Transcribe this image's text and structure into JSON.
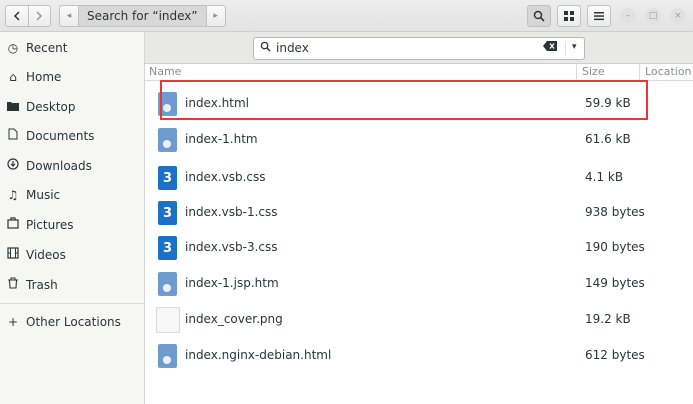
{
  "header": {
    "back_icon": "chevron-left-icon",
    "forward_icon": "chevron-right-icon",
    "path_left_arrow": "◂",
    "search_crumb": "Search for “index”",
    "path_right_arrow": "▸",
    "search_icon": "🔍",
    "view_icon": "grid-icon",
    "menu_icon": "hamburger-icon"
  },
  "window_controls": {
    "minimize": "–",
    "maximize": "□",
    "close": "×"
  },
  "sidebar": {
    "items": [
      {
        "icon": "clock-icon",
        "label": "Recent"
      },
      {
        "icon": "home-icon",
        "label": "Home"
      },
      {
        "icon": "folder-icon",
        "label": "Desktop"
      },
      {
        "icon": "document-icon",
        "label": "Documents"
      },
      {
        "icon": "download-icon",
        "label": "Downloads"
      },
      {
        "icon": "music-icon",
        "label": "Music"
      },
      {
        "icon": "pictures-icon",
        "label": "Pictures"
      },
      {
        "icon": "video-icon",
        "label": "Videos"
      },
      {
        "icon": "trash-icon",
        "label": "Trash"
      }
    ],
    "other_locations": {
      "icon": "plus-icon",
      "label": "Other Locations"
    }
  },
  "search": {
    "value": "index",
    "placeholder": ""
  },
  "columns": {
    "name": "Name",
    "size": "Size",
    "location": "Location"
  },
  "files": [
    {
      "name": "index.html",
      "size": "59.9 kB",
      "type": "html"
    },
    {
      "name": "index-1.htm",
      "size": "61.6 kB",
      "type": "html"
    },
    {
      "name": "index.vsb.css",
      "size": "4.1 kB",
      "type": "css"
    },
    {
      "name": "index.vsb-1.css",
      "size": "938 bytes",
      "type": "css"
    },
    {
      "name": "index.vsb-3.css",
      "size": "190 bytes",
      "type": "css"
    },
    {
      "name": "index-1.jsp.htm",
      "size": "149 bytes",
      "type": "html"
    },
    {
      "name": "index_cover.png",
      "size": "19.2 kB",
      "type": "png"
    },
    {
      "name": "index.nginx-debian.html",
      "size": "612 bytes",
      "type": "html"
    }
  ],
  "colors": {
    "highlight": "#e53935",
    "html_icon": "#6f9bd1",
    "css_icon": "#1a71c5"
  }
}
